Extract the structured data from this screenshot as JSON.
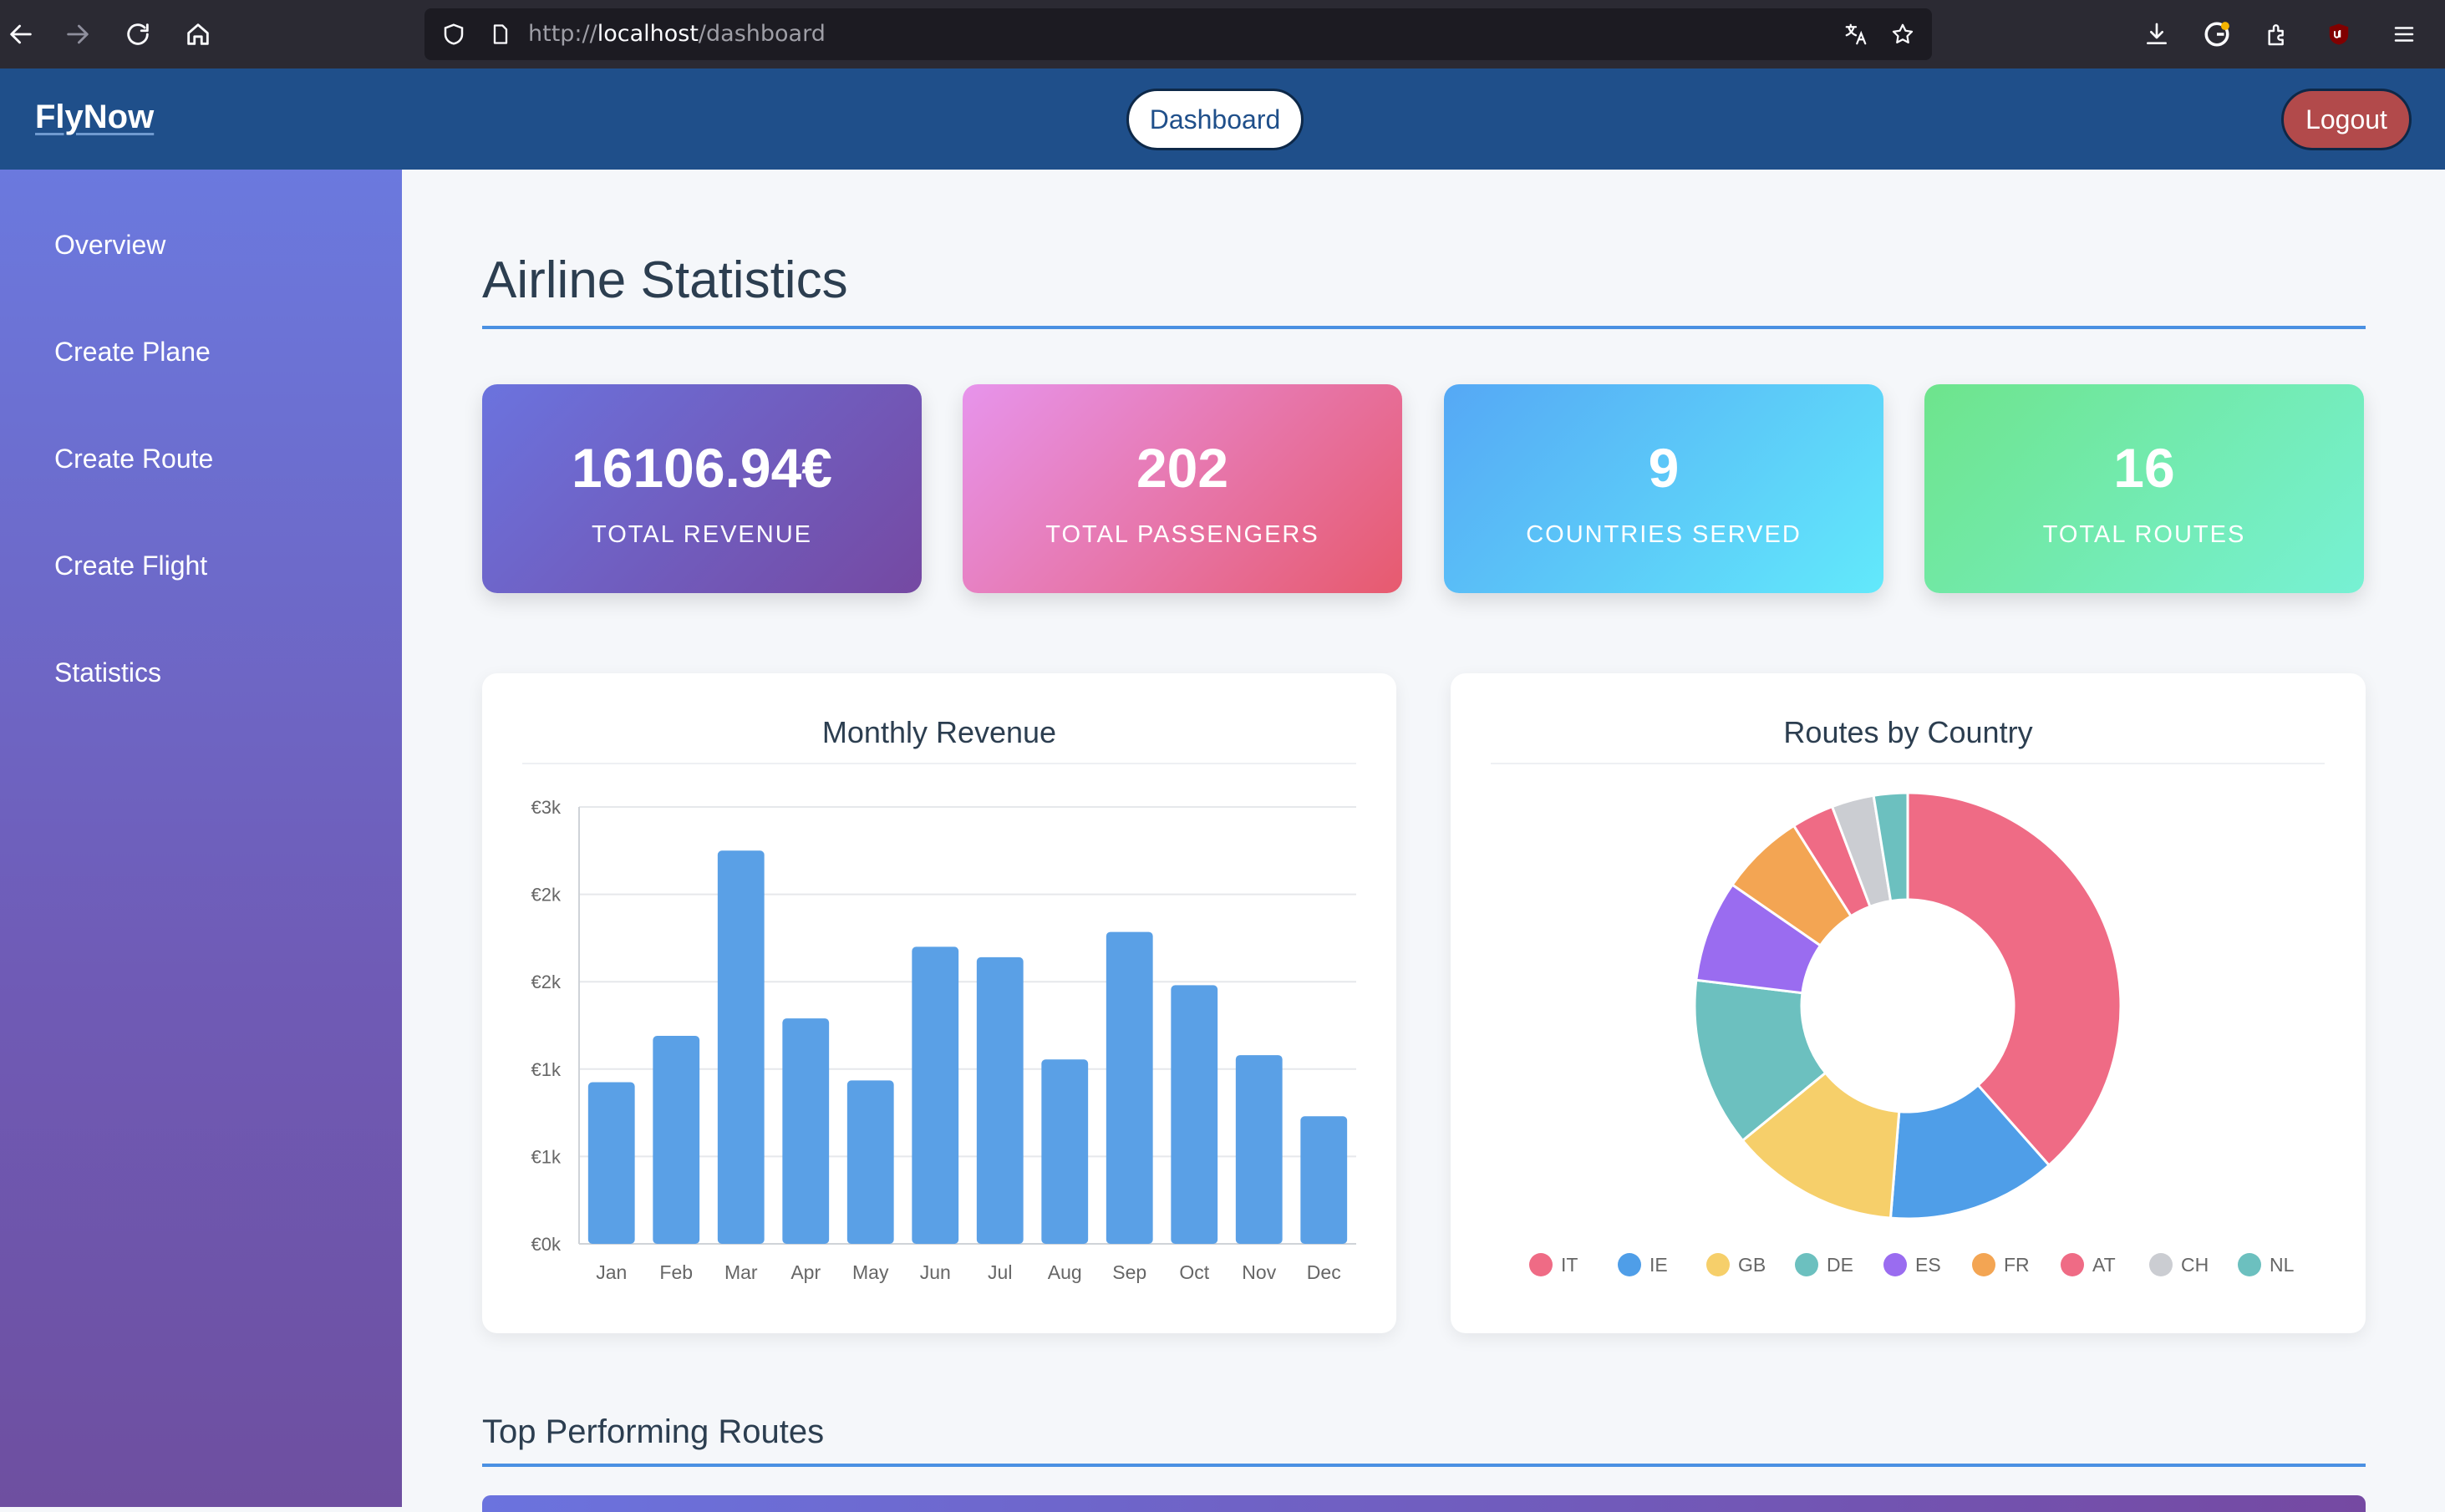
{
  "browser": {
    "url_prefix": "http://",
    "url_host": "localhost",
    "url_path": "/dashboard"
  },
  "header": {
    "brand": "FlyNow",
    "dashboard_label": "Dashboard",
    "logout_label": "Logout"
  },
  "sidebar": {
    "items": [
      {
        "label": "Overview"
      },
      {
        "label": "Create Plane"
      },
      {
        "label": "Create Route"
      },
      {
        "label": "Create Flight"
      },
      {
        "label": "Statistics"
      }
    ]
  },
  "main": {
    "title": "Airline Statistics",
    "stats": [
      {
        "value": "16106.94€",
        "label": "TOTAL REVENUE"
      },
      {
        "value": "202",
        "label": "TOTAL PASSENGERS"
      },
      {
        "value": "9",
        "label": "COUNTRIES SERVED"
      },
      {
        "value": "16",
        "label": "TOTAL ROUTES"
      }
    ],
    "section_title": "Top Performing Routes"
  },
  "chart_data": [
    {
      "type": "bar",
      "title": "Monthly Revenue",
      "categories": [
        "Jan",
        "Feb",
        "Mar",
        "Apr",
        "May",
        "Jun",
        "Jul",
        "Aug",
        "Sep",
        "Oct",
        "Nov",
        "Dec"
      ],
      "values": [
        925,
        1190,
        2250,
        1290,
        935,
        1700,
        1640,
        1055,
        1785,
        1480,
        1080,
        730
      ],
      "ylim": [
        0,
        2500
      ],
      "ytick_values": [
        0,
        500,
        1000,
        1500,
        2000,
        2500
      ],
      "ytick_labels": [
        "€0k",
        "€1k",
        "€1k",
        "€2k",
        "€2k",
        "€3k"
      ],
      "color": "#5aa0e6",
      "grid": true
    },
    {
      "type": "pie",
      "title": "Routes by Country",
      "donut": true,
      "legend_position": "bottom",
      "labels": [
        "IT",
        "IE",
        "GB",
        "DE",
        "ES",
        "FR",
        "AT",
        "CH",
        "NL"
      ],
      "values": [
        6,
        2,
        2,
        2,
        1.2,
        1,
        0.5,
        0.5,
        0.4
      ],
      "colors": [
        "#ef6b85",
        "#4f9ee8",
        "#f6cf6a",
        "#6cc0bf",
        "#9a6cf0",
        "#f3a553",
        "#ef6b85",
        "#cbcdd2",
        "#6cc0bf"
      ]
    }
  ]
}
